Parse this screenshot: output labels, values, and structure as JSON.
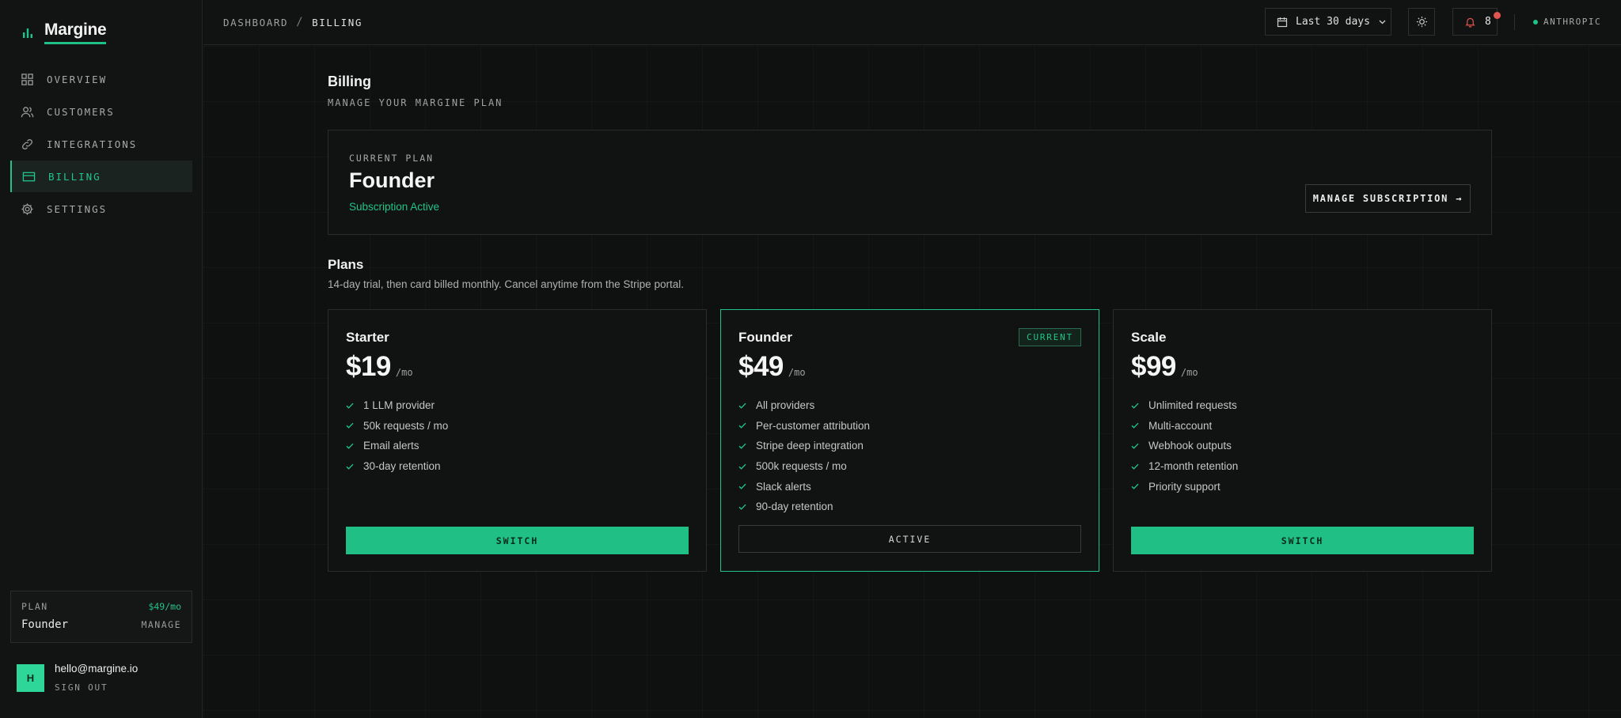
{
  "brand": {
    "name": "Margine"
  },
  "sidebar": {
    "items": [
      {
        "label": "OVERVIEW",
        "icon": "grid-icon"
      },
      {
        "label": "CUSTOMERS",
        "icon": "users-icon"
      },
      {
        "label": "INTEGRATIONS",
        "icon": "link-icon"
      },
      {
        "label": "BILLING",
        "icon": "credit-card-icon",
        "active": true
      },
      {
        "label": "SETTINGS",
        "icon": "gear-icon"
      }
    ],
    "plan": {
      "label": "PLAN",
      "price": "$49/mo",
      "name": "Founder",
      "manage": "MANAGE"
    },
    "user": {
      "initial": "H",
      "email": "hello@margine.io",
      "signout": "SIGN OUT"
    }
  },
  "header": {
    "breadcrumb": [
      "DASHBOARD",
      "BILLING"
    ],
    "breadcrumb_sep": "/",
    "range": "Last 30 days",
    "notifications": "8",
    "org": "ANTHROPIC"
  },
  "page": {
    "title": "Billing",
    "subtitle": "MANAGE YOUR MARGINE PLAN"
  },
  "current_plan": {
    "label": "CURRENT PLAN",
    "name": "Founder",
    "status": "Subscription Active",
    "manage_label": "MANAGE SUBSCRIPTION →"
  },
  "plans_section": {
    "title": "Plans",
    "subtitle": "14-day trial, then card billed monthly. Cancel anytime from the Stripe portal."
  },
  "plans": [
    {
      "name": "Starter",
      "price": "$19",
      "per": "/mo",
      "features": [
        "1 LLM provider",
        "50k requests / mo",
        "Email alerts",
        "30-day retention"
      ],
      "button": "SWITCH"
    },
    {
      "name": "Founder",
      "price": "$49",
      "per": "/mo",
      "badge": "CURRENT",
      "features": [
        "All providers",
        "Per-customer attribution",
        "Stripe deep integration",
        "500k requests / mo",
        "Slack alerts",
        "90-day retention"
      ],
      "button": "ACTIVE"
    },
    {
      "name": "Scale",
      "price": "$99",
      "per": "/mo",
      "features": [
        "Unlimited requests",
        "Multi-account",
        "Webhook outputs",
        "12-month retention",
        "Priority support"
      ],
      "button": "SWITCH"
    }
  ],
  "colors": {
    "accent": "#21c488",
    "background": "#0f1010",
    "alert": "#e05550"
  }
}
